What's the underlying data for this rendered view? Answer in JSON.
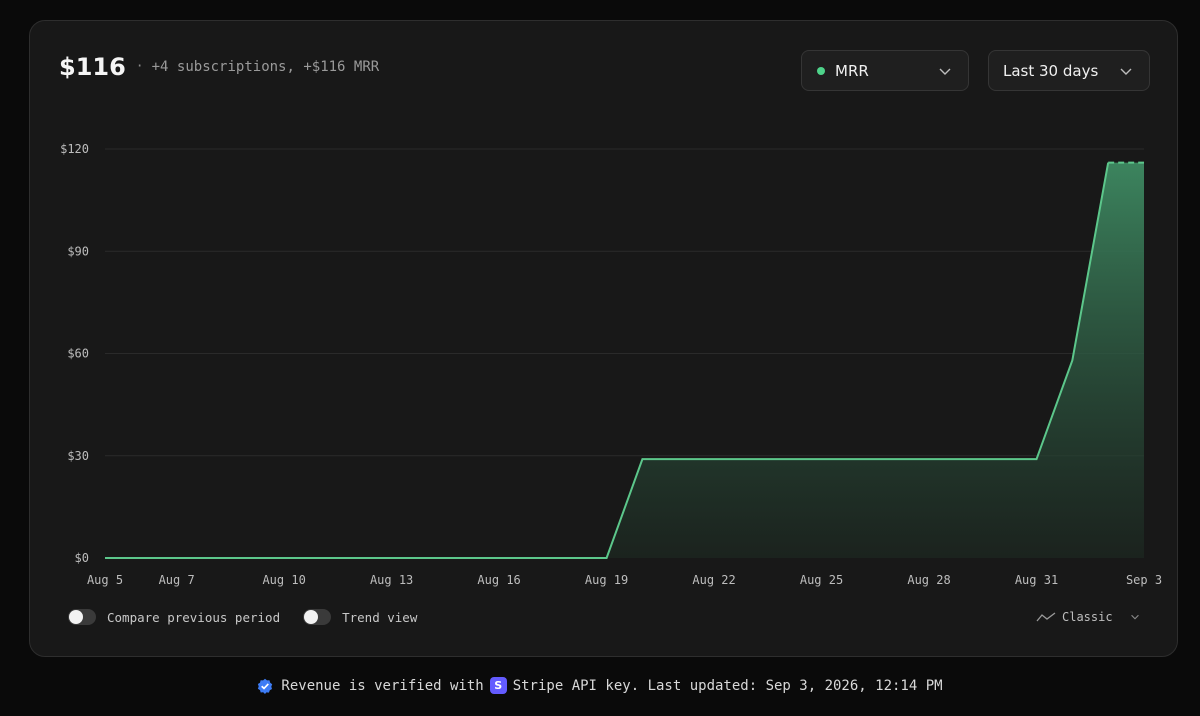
{
  "header": {
    "total": "$116",
    "separator": "·",
    "summary": "+4 subscriptions, +$116 MRR"
  },
  "metric_dropdown": {
    "label": "MRR",
    "dot_color": "#4ed38a",
    "icon": "chevron-down-icon"
  },
  "range_dropdown": {
    "label": "Last 30 days",
    "icon": "chevron-down-icon"
  },
  "chart_data": {
    "type": "area",
    "series": [
      {
        "name": "MRR",
        "color": "#5cc78b",
        "x": [
          "Aug 5",
          "Aug 19",
          "Aug 20",
          "Aug 31",
          "Sep 1",
          "Sep 2",
          "Sep 3"
        ],
        "values": [
          0,
          0,
          29,
          29,
          58,
          116,
          116
        ]
      }
    ],
    "x_ticks": [
      "Aug 5",
      "Aug 7",
      "Aug 10",
      "Aug 13",
      "Aug 16",
      "Aug 19",
      "Aug 22",
      "Aug 25",
      "Aug 28",
      "Aug 31",
      "Sep 3"
    ],
    "y_ticks": [
      "$0",
      "$30",
      "$60",
      "$90",
      "$120"
    ],
    "ylim": [
      0,
      120
    ],
    "grid": true,
    "partial_period": "Sep 2 – Sep 3 dashed"
  },
  "controls": {
    "compare_label": "Compare previous period",
    "compare_on": false,
    "trend_label": "Trend view",
    "trend_on": false,
    "view_label": "Classic",
    "view_icon": "line-chart-icon"
  },
  "footer": {
    "verified_icon": "verified-badge-icon",
    "text_before": "Revenue is verified with",
    "stripe_letter": "S",
    "text_after": "Stripe API key. Last updated: Sep 3, 2026, 12:14 PM"
  }
}
